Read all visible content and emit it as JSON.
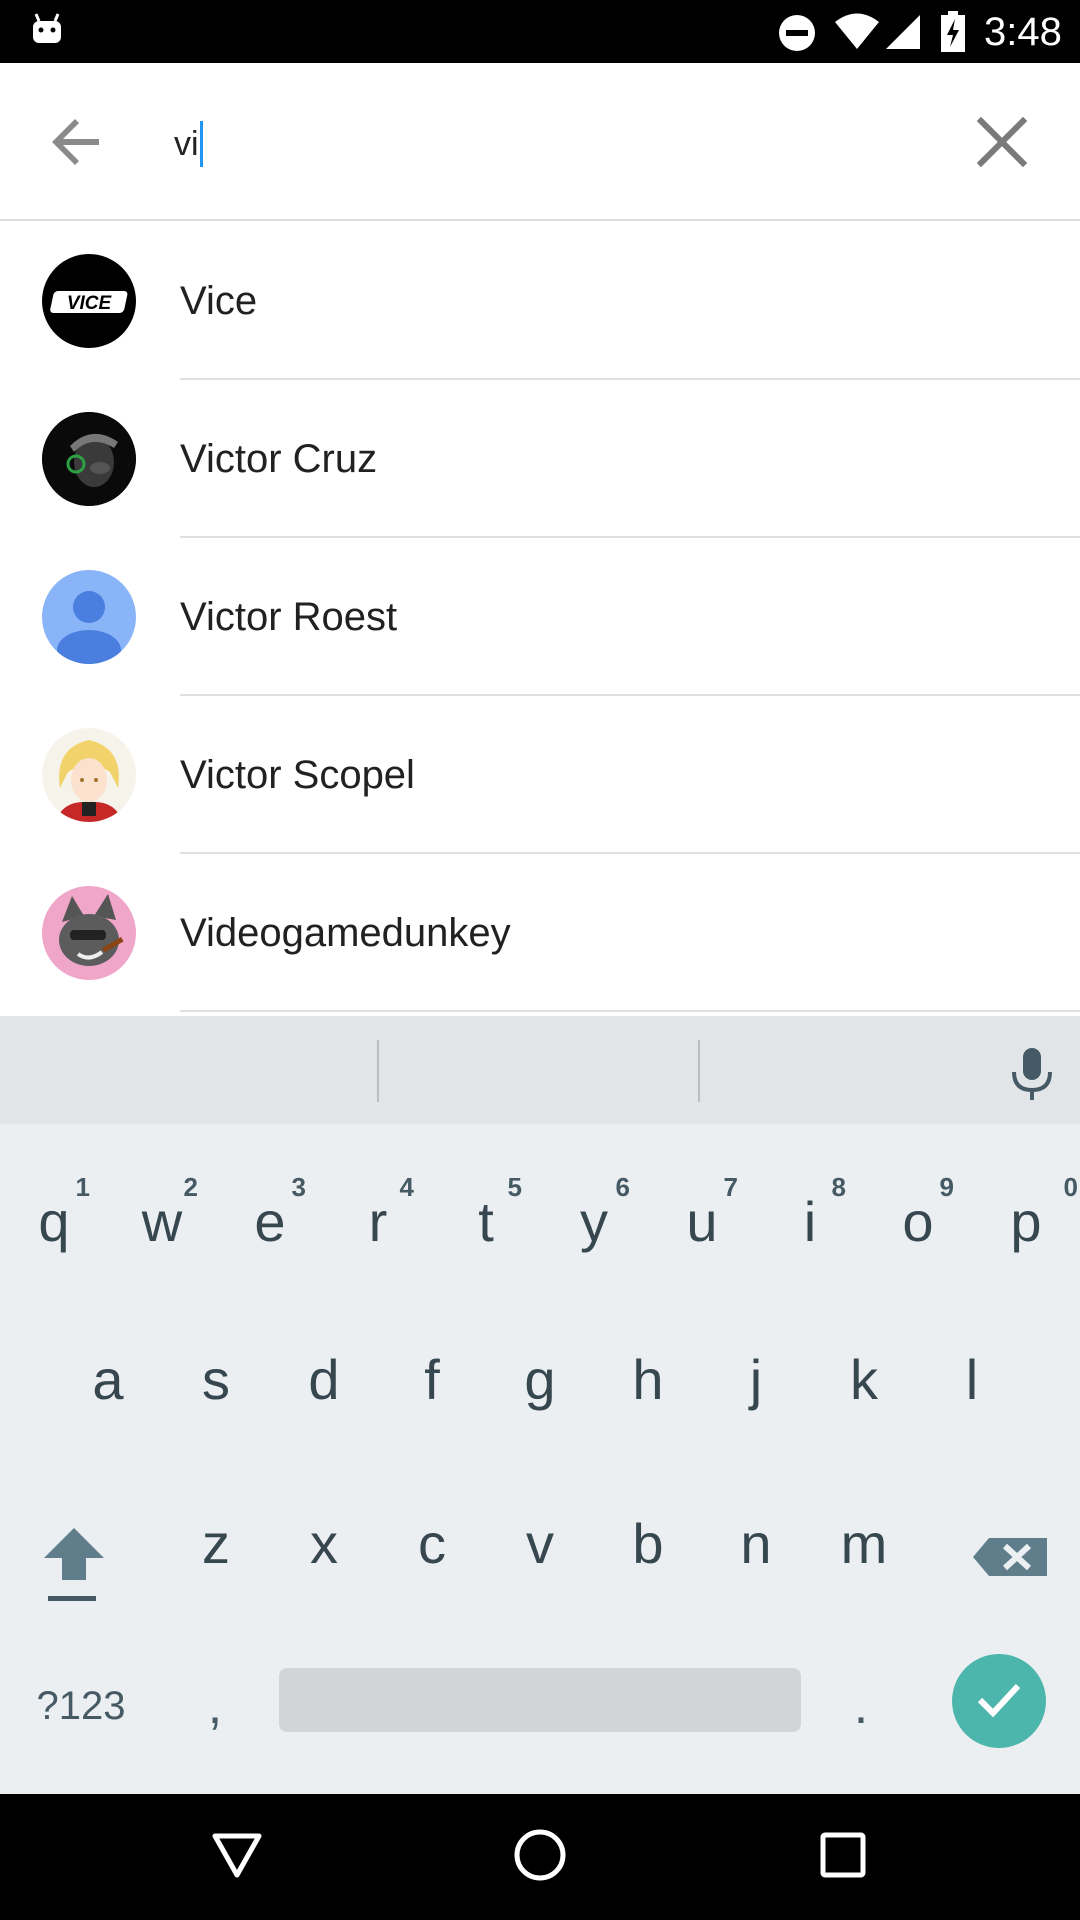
{
  "status_bar": {
    "time": "3:48",
    "icons": [
      "android-debug-icon",
      "do-not-disturb-icon",
      "wifi-icon",
      "cell-signal-icon",
      "battery-charging-icon"
    ]
  },
  "search": {
    "query": "vi",
    "back_icon": "arrow-back-icon",
    "clear_icon": "close-icon"
  },
  "results": [
    {
      "name": "Vice",
      "avatar": "vice-logo"
    },
    {
      "name": "Victor Cruz",
      "avatar": "photo"
    },
    {
      "name": "Victor Roest",
      "avatar": "default-person-icon"
    },
    {
      "name": "Victor Scopel",
      "avatar": "anime-portrait"
    },
    {
      "name": "Videogamedunkey",
      "avatar": "cartoon-portrait"
    }
  ],
  "keyboard": {
    "row1": [
      {
        "key": "q",
        "hint": "1"
      },
      {
        "key": "w",
        "hint": "2"
      },
      {
        "key": "e",
        "hint": "3"
      },
      {
        "key": "r",
        "hint": "4"
      },
      {
        "key": "t",
        "hint": "5"
      },
      {
        "key": "y",
        "hint": "6"
      },
      {
        "key": "u",
        "hint": "7"
      },
      {
        "key": "i",
        "hint": "8"
      },
      {
        "key": "o",
        "hint": "9"
      },
      {
        "key": "p",
        "hint": "0"
      }
    ],
    "row2": [
      "a",
      "s",
      "d",
      "f",
      "g",
      "h",
      "j",
      "k",
      "l"
    ],
    "row3": [
      "z",
      "x",
      "c",
      "v",
      "b",
      "n",
      "m"
    ],
    "symbols_label": "?123",
    "comma": ",",
    "period": ".",
    "colors": {
      "background": "#eceff1",
      "enter": "#4db6ac",
      "key_text": "#37474f"
    }
  },
  "nav_bar": {
    "icons": [
      "back-triangle-icon",
      "home-circle-icon",
      "recents-square-icon"
    ]
  }
}
